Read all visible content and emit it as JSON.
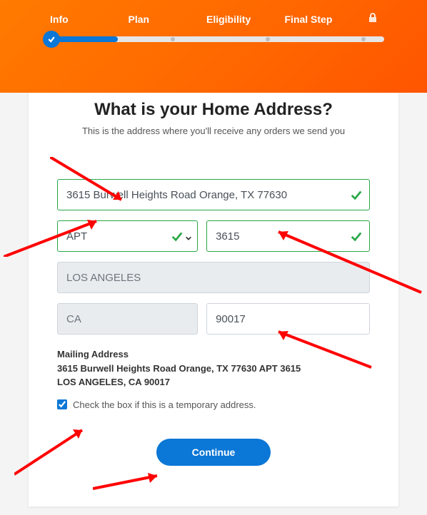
{
  "stepper": {
    "steps": [
      "Info",
      "Plan",
      "Eligibility",
      "Final Step"
    ]
  },
  "heading": {
    "title": "What is your Home Address?",
    "subtitle": "This is the address where you'll receive any orders we send you"
  },
  "form": {
    "address": "3615 Burwell Heights Road Orange, TX 77630",
    "apt_type": "APT",
    "apt_number": "3615",
    "city": "LOS ANGELES",
    "state": "CA",
    "zip": "90017"
  },
  "mailing": {
    "label": "Mailing Address",
    "line1": "3615 Burwell Heights Road Orange, TX 77630 APT 3615",
    "line2": "LOS ANGELES, CA 90017"
  },
  "temporary": {
    "label": "Check the box if this is a temporary address.",
    "checked": true
  },
  "actions": {
    "continue": "Continue"
  }
}
